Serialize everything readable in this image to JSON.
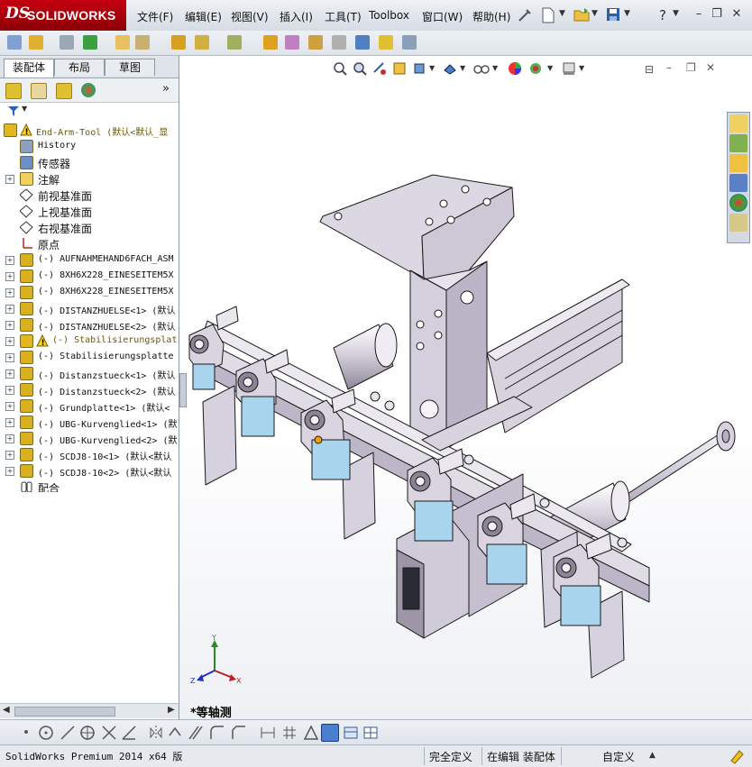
{
  "app": {
    "logo_ds": "DS",
    "logo_name": "SOLIDWORKS"
  },
  "menu": [
    "文件(F)",
    "编辑(E)",
    "视图(V)",
    "插入(I)",
    "工具(T)",
    "Toolbox",
    "窗口(W)",
    "帮助(H)"
  ],
  "tabs": [
    "装配体",
    "布局",
    "草图"
  ],
  "tree": [
    {
      "label": "End-Arm-Tool  (默认<默认_显",
      "icon": "assembly-warning-icon",
      "level": 0,
      "expand": false,
      "cn": false,
      "warn": true
    },
    {
      "label": "History",
      "icon": "history-icon",
      "level": 1,
      "expand": false,
      "cn": false
    },
    {
      "label": "传感器",
      "icon": "sensor-icon",
      "level": 1,
      "expand": false,
      "cn": true
    },
    {
      "label": "注解",
      "icon": "annotation-icon",
      "level": 1,
      "expand": true,
      "cn": true
    },
    {
      "label": "前视基准面",
      "icon": "plane-icon",
      "level": 1,
      "expand": false,
      "cn": true
    },
    {
      "label": "上视基准面",
      "icon": "plane-icon",
      "level": 1,
      "expand": false,
      "cn": true
    },
    {
      "label": "右视基准面",
      "icon": "plane-icon",
      "level": 1,
      "expand": false,
      "cn": true
    },
    {
      "label": "原点",
      "icon": "origin-icon",
      "level": 1,
      "expand": false,
      "cn": true
    },
    {
      "label": "(-) AUFNAHMEHAND6FACH_ASM",
      "icon": "part-icon",
      "level": 1,
      "expand": true,
      "cn": false
    },
    {
      "label": "(-) 8XH6X228_EINESEITEM5X",
      "icon": "part-icon",
      "level": 1,
      "expand": true,
      "cn": false
    },
    {
      "label": "(-) 8XH6X228_EINESEITEM5X",
      "icon": "part-icon",
      "level": 1,
      "expand": true,
      "cn": false
    },
    {
      "label": "(-) DISTANZHUELSE<1> (默认",
      "icon": "part-icon",
      "level": 1,
      "expand": true,
      "cn": false
    },
    {
      "label": "(-) DISTANZHUELSE<2> (默认",
      "icon": "part-icon",
      "level": 1,
      "expand": true,
      "cn": false
    },
    {
      "label": "(-) Stabilisierungsplat",
      "icon": "assembly-warning-icon",
      "level": 1,
      "expand": true,
      "cn": false,
      "warn": true
    },
    {
      "label": "(-) Stabilisierungsplatte",
      "icon": "part-icon",
      "level": 1,
      "expand": true,
      "cn": false
    },
    {
      "label": "(-) Distanzstueck<1> (默认",
      "icon": "part-icon",
      "level": 1,
      "expand": true,
      "cn": false
    },
    {
      "label": "(-) Distanzstueck<2> (默认",
      "icon": "part-icon",
      "level": 1,
      "expand": true,
      "cn": false
    },
    {
      "label": "(-) Grundplatte<1> (默认<",
      "icon": "part-icon",
      "level": 1,
      "expand": true,
      "cn": false
    },
    {
      "label": "(-) UBG-Kurvenglied<1> (默",
      "icon": "part-icon",
      "level": 1,
      "expand": true,
      "cn": false
    },
    {
      "label": "(-) UBG-Kurvenglied<2> (默",
      "icon": "part-icon",
      "level": 1,
      "expand": true,
      "cn": false
    },
    {
      "label": "(-) SCDJ8-10<1> (默认<默认",
      "icon": "part-icon",
      "level": 1,
      "expand": true,
      "cn": false
    },
    {
      "label": "(-) SCDJ8-10<2> (默认<默认",
      "icon": "part-icon",
      "level": 1,
      "expand": true,
      "cn": false
    },
    {
      "label": "配合",
      "icon": "mates-icon",
      "level": 1,
      "expand": false,
      "cn": true
    }
  ],
  "view_label": "*等轴测",
  "status": {
    "product": "SolidWorks Premium 2014 x64 版",
    "definition": "完全定义",
    "editing": "在编辑 装配体",
    "units": "自定义"
  },
  "colors": {
    "brand": "#b00010",
    "model_body": "#c9c4d3",
    "model_edge": "#1a1a1a",
    "sensor_blue": "#a8d4ee"
  }
}
